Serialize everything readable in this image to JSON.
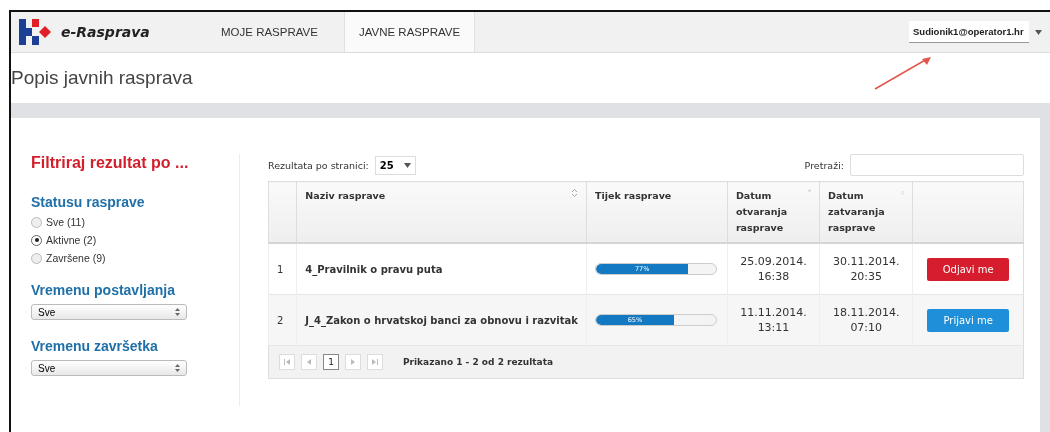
{
  "nav": {
    "brand": "e-Rasprava",
    "tabs": [
      {
        "label": "MOJE RASPRAVE",
        "selected": false
      },
      {
        "label": "JAVNE RASPRAVE",
        "selected": true
      }
    ],
    "user": "Sudionik1@operator1.hr"
  },
  "page_title": "Popis javnih rasprava",
  "filters": {
    "heading": "Filtriraj rezultat po ...",
    "status": {
      "title": "Statusu rasprave",
      "options": [
        {
          "label": "Sve (11)",
          "selected": false
        },
        {
          "label": "Aktivne (2)",
          "selected": true
        },
        {
          "label": "Završene (9)",
          "selected": false
        }
      ]
    },
    "selects": [
      {
        "title": "Vremenu postavljanja",
        "value": "Sve"
      },
      {
        "title": "Vremenu završetka",
        "value": "Sve"
      }
    ]
  },
  "table": {
    "page_size_label": "Rezultata po stranici:",
    "page_size": "25",
    "search_label": "Pretraži:",
    "columns": [
      {
        "label": "Naziv rasprave",
        "sortable": true,
        "sorted": false
      },
      {
        "label": "Tijek rasprave",
        "sortable": false
      },
      {
        "label": "Datum otvaranja rasprave",
        "sortable": true,
        "sorted": true
      },
      {
        "label": "Datum zatvaranja rasprave",
        "sortable": true,
        "sorted": false
      }
    ],
    "rows": [
      {
        "index": "1",
        "name": "4_Pravilnik o pravu puta",
        "level": 0.77,
        "progress": "77%",
        "opened": [
          "25.09.2014.",
          "16:38"
        ],
        "closed": [
          "30.11.2014.",
          "20:35"
        ],
        "action": {
          "kind": "leave",
          "label": "Odjavi me"
        }
      },
      {
        "index": "2",
        "name": "J_4_Zakon o hrvatskoj banci za obnovu i razvitak",
        "level": 0.65,
        "progress": "65%",
        "opened": [
          "11.11.2014.",
          "13:11"
        ],
        "closed": [
          "18.11.2014.",
          "07:10"
        ],
        "action": {
          "kind": "join",
          "label": "Prijavi me"
        }
      }
    ],
    "pagination": {
      "current": "1",
      "info": "Prikazano 1 - 2 od 2 rezultata"
    }
  }
}
